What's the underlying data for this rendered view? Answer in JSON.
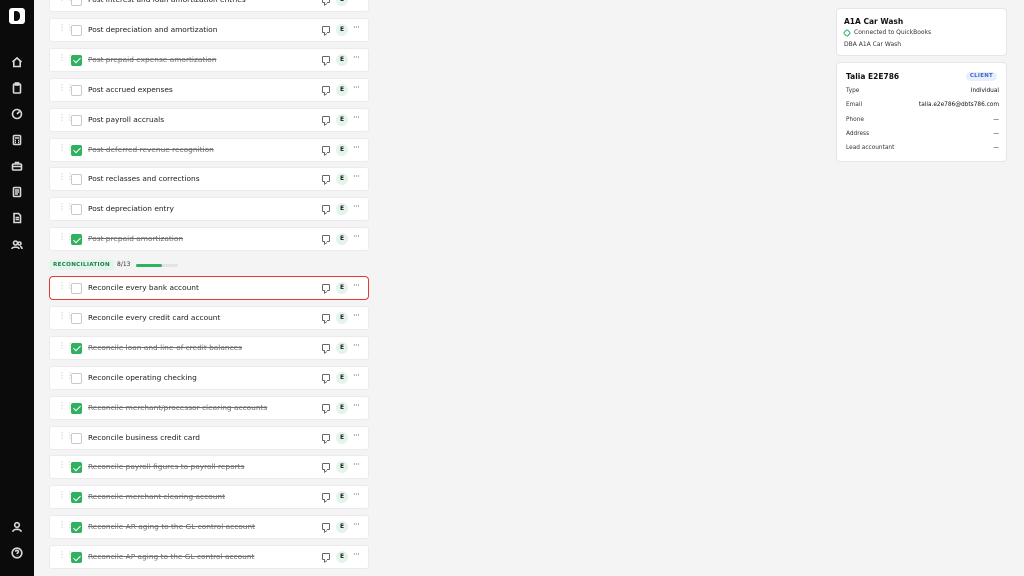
{
  "sidebar": {
    "nav": [
      {
        "name": "home-icon"
      },
      {
        "name": "clipboard-icon"
      },
      {
        "name": "gauge-icon"
      },
      {
        "name": "calculator-icon"
      },
      {
        "name": "briefcase-icon"
      },
      {
        "name": "ledger-icon"
      },
      {
        "name": "document-icon"
      },
      {
        "name": "users-icon"
      }
    ],
    "bottom": [
      {
        "name": "profile-icon"
      },
      {
        "name": "help-icon"
      }
    ]
  },
  "tasks_top": [
    {
      "label": "Post interest and loan amortization entries",
      "done": false,
      "assignee": "E"
    },
    {
      "label": "Post depreciation and amortization",
      "done": false,
      "assignee": "E"
    },
    {
      "label": "Post prepaid expense amortization",
      "done": true,
      "assignee": "E"
    },
    {
      "label": "Post accrued expenses",
      "done": false,
      "assignee": "E"
    },
    {
      "label": "Post payroll accruals",
      "done": false,
      "assignee": "E"
    },
    {
      "label": "Post deferred revenue recognition",
      "done": true,
      "assignee": "E"
    },
    {
      "label": "Post reclasses and corrections",
      "done": false,
      "assignee": "E"
    },
    {
      "label": "Post depreciation entry",
      "done": false,
      "assignee": "E"
    },
    {
      "label": "Post prepaid amortization",
      "done": true,
      "assignee": "E"
    }
  ],
  "section": {
    "name": "RECONCILIATION",
    "count": "8/13",
    "progress": 0.62
  },
  "tasks_recon": [
    {
      "label": "Reconcile every bank account",
      "done": false,
      "assignee": "E",
      "selected": true
    },
    {
      "label": "Reconcile every credit card account",
      "done": false,
      "assignee": "E"
    },
    {
      "label": "Reconcile loan and line-of-credit balances",
      "done": true,
      "assignee": "E"
    },
    {
      "label": "Reconcile operating checking",
      "done": false,
      "assignee": "E"
    },
    {
      "label": "Reconcile merchant/processor clearing accounts",
      "done": true,
      "assignee": "E"
    },
    {
      "label": "Reconcile business credit card",
      "done": false,
      "assignee": "E"
    },
    {
      "label": "Reconcile payroll figures to payroll reports",
      "done": true,
      "assignee": "E"
    },
    {
      "label": "Reconcile merchant clearing account",
      "done": true,
      "assignee": "E"
    },
    {
      "label": "Reconcile AR aging to the GL control account",
      "done": true,
      "assignee": "E"
    },
    {
      "label": "Reconcile AP aging to the GL control account",
      "done": true,
      "assignee": "E"
    }
  ],
  "company": {
    "name": "A1A Car Wash",
    "connection": "Connected to QuickBooks",
    "dba": "DBA A1A Car Wash"
  },
  "client": {
    "name": "Talia E2E786",
    "badge": "CLIENT",
    "fields": [
      {
        "key": "Type",
        "value": "Individual"
      },
      {
        "key": "Email",
        "value": "talia.e2e786@dbts786.com"
      },
      {
        "key": "Phone",
        "value": "—"
      },
      {
        "key": "Address",
        "value": "—"
      },
      {
        "key": "Lead accountant",
        "value": "—"
      }
    ]
  },
  "colors": {
    "accent": "#2fb160",
    "sidebar": "#0b0b0b",
    "selection": "#e53935"
  }
}
